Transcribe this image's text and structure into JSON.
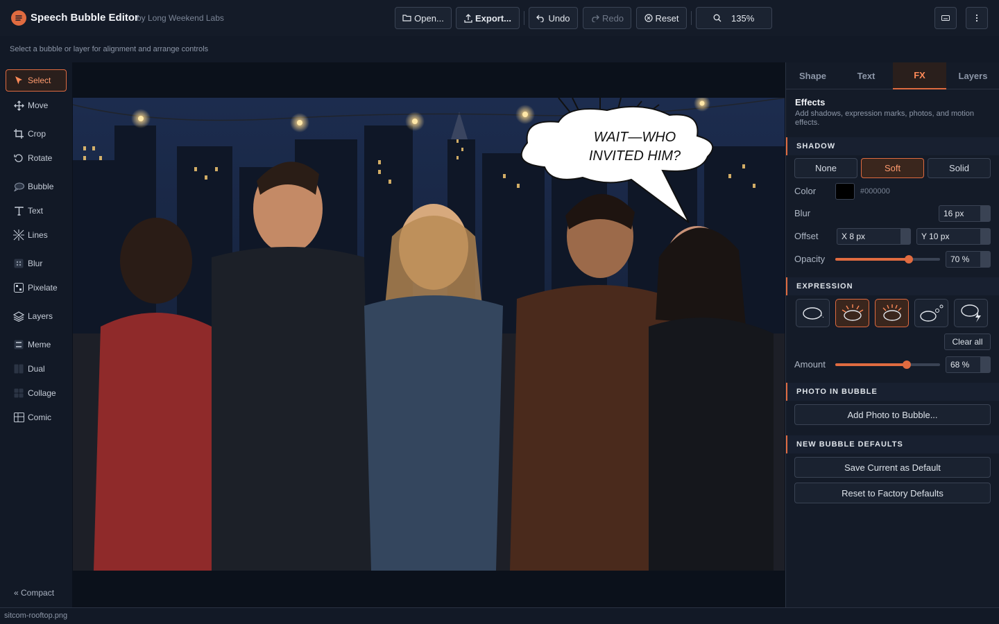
{
  "app": {
    "title": "Speech Bubble Editor",
    "subtitle": "by Long Weekend Labs"
  },
  "toolbar": {
    "open": "Open...",
    "export": "Export...",
    "undo": "Undo",
    "redo": "Redo",
    "reset": "Reset",
    "zoom": "135%"
  },
  "hint": "Select a bubble or layer for alignment and arrange controls",
  "tools": [
    {
      "label": "Select",
      "icon": "cursor-icon",
      "active": true
    },
    {
      "label": "Move",
      "icon": "move-icon"
    },
    {
      "label": "Crop",
      "icon": "crop-icon"
    },
    {
      "label": "Rotate",
      "icon": "rotate-icon"
    },
    {
      "label": "Bubble",
      "icon": "bubble-icon"
    },
    {
      "label": "Text",
      "icon": "text-icon"
    },
    {
      "label": "Lines",
      "icon": "lines-icon"
    },
    {
      "label": "Blur",
      "icon": "blur-icon"
    },
    {
      "label": "Pixelate",
      "icon": "pixelate-icon"
    },
    {
      "label": "Layers",
      "icon": "layers-icon"
    },
    {
      "label": "Meme",
      "icon": "meme-icon"
    },
    {
      "label": "Dual",
      "icon": "dual-icon"
    },
    {
      "label": "Collage",
      "icon": "collage-icon"
    },
    {
      "label": "Comic",
      "icon": "comic-icon"
    }
  ],
  "compact": "« Compact",
  "canvas": {
    "bubble_line1": "WAIT—WHO",
    "bubble_line2": "INVITED HIM?"
  },
  "panel": {
    "tabs": [
      "Shape",
      "Text",
      "FX",
      "Layers"
    ],
    "active_tab": "FX",
    "effects_title": "Effects",
    "effects_desc": "Add shadows, expression marks, photos, and motion effects.",
    "shadow": {
      "heading": "SHADOW",
      "options": [
        "None",
        "Soft",
        "Solid"
      ],
      "selected": "Soft",
      "color_label": "Color",
      "color_value": "#000000",
      "blur_label": "Blur",
      "blur_value": "16 px",
      "offset_label": "Offset",
      "offset_x": "X 8 px",
      "offset_y": "Y 10 px",
      "opacity_label": "Opacity",
      "opacity_value": "70 %",
      "opacity_fraction": 0.7
    },
    "expression": {
      "heading": "EXPRESSION",
      "clear_all": "Clear all",
      "amount_label": "Amount",
      "amount_value": "68 %",
      "amount_fraction": 0.68
    },
    "photo_in_bubble": {
      "heading": "PHOTO IN BUBBLE",
      "button": "Add Photo to Bubble..."
    },
    "defaults": {
      "heading": "NEW BUBBLE DEFAULTS",
      "save": "Save Current as Default",
      "reset": "Reset to Factory Defaults"
    }
  },
  "status": {
    "filename": "sitcom-rooftop.png"
  },
  "colors": {
    "accent": "#e06b40",
    "bg": "#121926",
    "panel": "#141b28"
  }
}
